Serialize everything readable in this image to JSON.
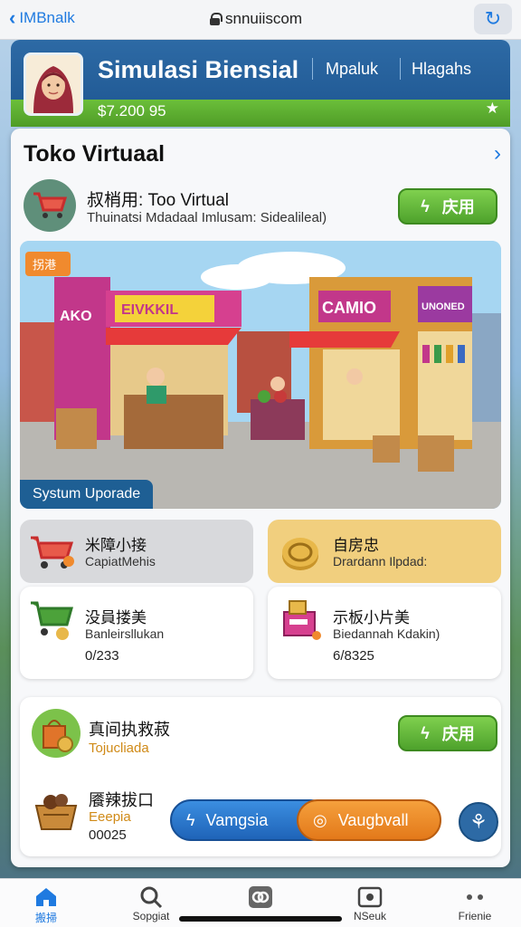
{
  "browser": {
    "back_label": "IMBnalk",
    "url": "snnuiiscom"
  },
  "header": {
    "title": "Simulasi Biensial",
    "tab_1": "Mpaluk",
    "tab_2": "Hlagahs",
    "balance": "$7.200 95"
  },
  "section": {
    "title": "Toko Virtuaal"
  },
  "store": {
    "name": "叔梢用: Too Virtual",
    "subtitle": "Thuinatsi Mdadaal Imlusam: Sidealileal)",
    "button_label": "庆用"
  },
  "scene": {
    "badge": "拐港",
    "caption": "Systum Uporade",
    "sign_left_1": "AKO",
    "sign_left_2": "EIVKKIL",
    "sign_right_1": "CAMIO",
    "sign_right_2": "UNONED"
  },
  "tiles": [
    {
      "title": "米障小接",
      "subtitle": "CapiatMehis"
    },
    {
      "title": "自房忠",
      "subtitle": "Drardann Ilpdad:"
    },
    {
      "title": "没員搂美",
      "subtitle": "Banleirsllukan",
      "value": "0/233"
    },
    {
      "title": "示板小片美",
      "subtitle": "Biedannah Kdakin)",
      "value": "6/8325"
    }
  ],
  "bottom_card": {
    "item_1_title": "真间执救菽",
    "item_1_subtitle": "Tojucliada",
    "item_1_button": "庆用",
    "item_2_title": "餍辣拔口",
    "item_2_subtitle": "Eeepia",
    "item_2_value": "00025"
  },
  "actions": {
    "pill_blue": "Vamgsia",
    "pill_orange": "Vaugbvall"
  },
  "nav": [
    {
      "label": "搬掃",
      "icon": "home-icon",
      "active": true
    },
    {
      "label": "Sopgiat",
      "icon": "search-icon",
      "active": false
    },
    {
      "label": "",
      "icon": "link-icon",
      "active": false
    },
    {
      "label": "NSeuk",
      "icon": "wallet-icon",
      "active": false
    },
    {
      "label": "Frienie",
      "icon": "more-icon",
      "active": false
    }
  ],
  "colors": {
    "header_blue": "#2d6aa5",
    "accent_green": "#4ea22c",
    "accent_orange": "#e3791a",
    "link_blue": "#1f7ae0"
  }
}
